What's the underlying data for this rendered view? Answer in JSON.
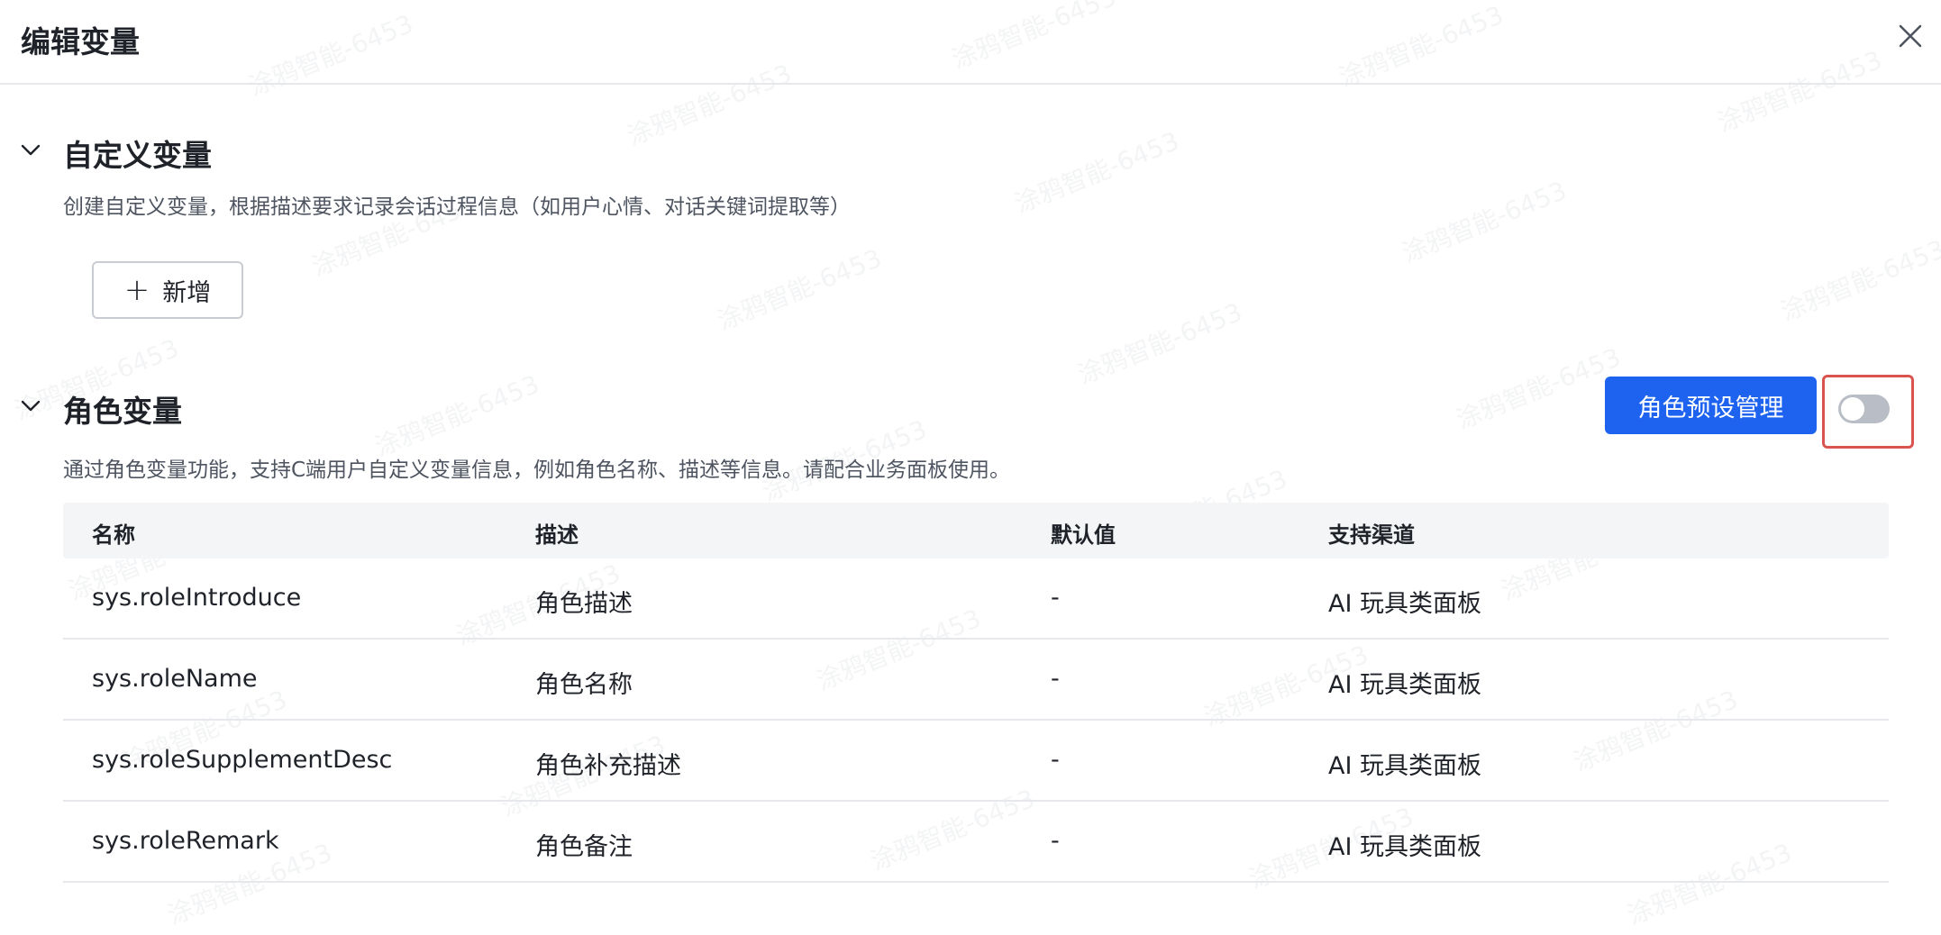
{
  "dialog": {
    "title": "编辑变量"
  },
  "custom_section": {
    "title": "自定义变量",
    "description": "创建自定义变量，根据描述要求记录会话过程信息（如用户心情、对话关键词提取等）",
    "add_button_label": "新增",
    "add_button_icon": "plus-icon"
  },
  "role_section": {
    "title": "角色变量",
    "description": "通过角色变量功能，支持C端用户自定义变量信息，例如角色名称、描述等信息。请配合业务面板使用。",
    "preset_button_label": "角色预设管理",
    "toggle_on": false
  },
  "table": {
    "columns": [
      "名称",
      "描述",
      "默认值",
      "支持渠道"
    ],
    "rows": [
      {
        "name": "sys.roleIntroduce",
        "desc": "角色描述",
        "default": "-",
        "channel": "AI 玩具类面板"
      },
      {
        "name": "sys.roleName",
        "desc": "角色名称",
        "default": "-",
        "channel": "AI 玩具类面板"
      },
      {
        "name": "sys.roleSupplementDesc",
        "desc": "角色补充描述",
        "default": "-",
        "channel": "AI 玩具类面板"
      },
      {
        "name": "sys.roleRemark",
        "desc": "角色备注",
        "default": "-",
        "channel": "AI 玩具类面板"
      }
    ]
  },
  "watermark": "涂鸦智能-6453",
  "colors": {
    "primary": "#1d63f0",
    "highlight_frame": "#d9534f",
    "toggle_off": "#b9bec6"
  }
}
